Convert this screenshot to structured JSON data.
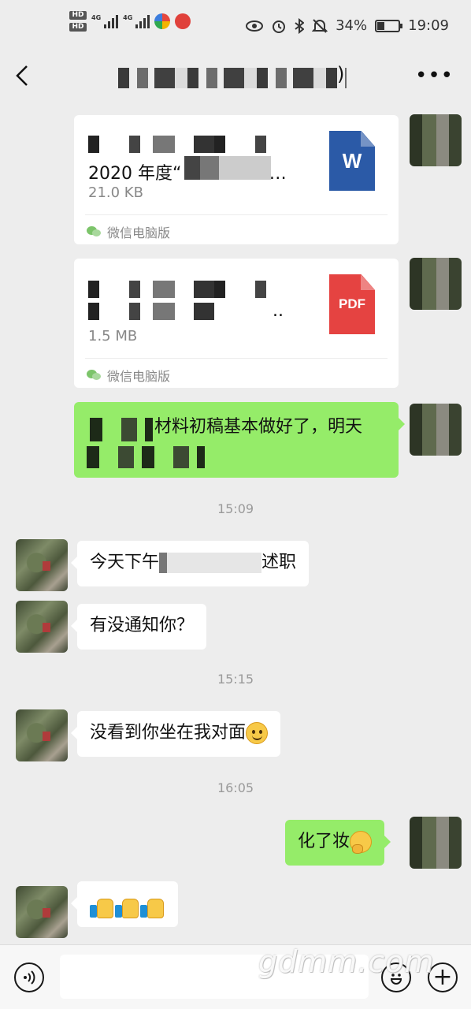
{
  "status_bar": {
    "hd1": "HD",
    "hd2": "HD",
    "net1": "4G",
    "net2": "4G",
    "battery": "34%",
    "battery_level": 0.34,
    "time": "19:09",
    "icons": [
      "eye-icon",
      "alarm-icon",
      "bluetooth-icon",
      "mute-icon"
    ]
  },
  "header": {
    "back_icon": "back-chevron-icon",
    "title_visible_suffix": ")",
    "more_icon": "more-dots-icon"
  },
  "messages": [
    {
      "type": "file",
      "direction": "out",
      "title": "2020 年度“",
      "title_suffix": "”…",
      "size": "21.0 KB",
      "source": "微信电脑版",
      "file_type": "W",
      "icon_color": "#2b5aa7"
    },
    {
      "type": "file",
      "direction": "out",
      "title_tail": "..",
      "size": "1.5 MB",
      "source": "微信电脑版",
      "file_type": "PDF",
      "icon_color": "#e54341"
    },
    {
      "type": "text",
      "direction": "out",
      "text": "材料初稿基本做好了，明天"
    },
    {
      "type": "time",
      "text": "15:09"
    },
    {
      "type": "text",
      "direction": "in",
      "prefix": "今天下午",
      "suffix": "述职"
    },
    {
      "type": "text",
      "direction": "in",
      "text": "有没通知你？"
    },
    {
      "type": "time",
      "text": "15:15"
    },
    {
      "type": "text",
      "direction": "in",
      "text": "没看到你坐在我对面",
      "emoji": "smile-emoji"
    },
    {
      "type": "time",
      "text": "16:05"
    },
    {
      "type": "text",
      "direction": "out",
      "text": "化了妆",
      "emoji": "thinking-emoji"
    },
    {
      "type": "emoji",
      "direction": "in",
      "emoji": "thumbs-up-emoji",
      "count": 3
    }
  ],
  "input_bar": {
    "voice_icon": "voice-icon",
    "emoji_icon": "emoji-icon",
    "plus_icon": "plus-icon",
    "input_value": ""
  },
  "watermark": "gdmm.com",
  "colors": {
    "background": "#ededed",
    "outgoing_bubble": "#95ec69",
    "incoming_bubble": "#ffffff",
    "word_icon": "#2b5aa7",
    "pdf_icon": "#e54341"
  }
}
